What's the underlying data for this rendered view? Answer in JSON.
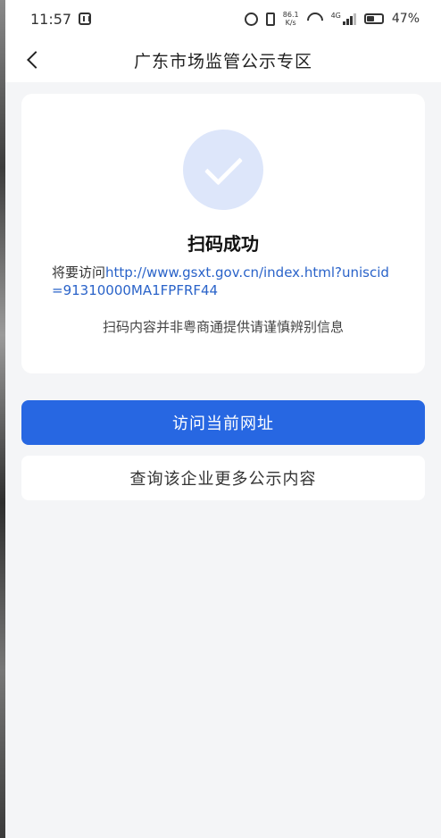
{
  "status_bar": {
    "time": "11:57",
    "net_speed_value": "86.1",
    "net_speed_unit": "K/s",
    "network_type": "4G",
    "battery": "47%",
    "battery_level": 0.47,
    "icons": [
      "nfc-icon",
      "alarm-icon",
      "vibrate-icon",
      "wifi-icon",
      "signal-icon",
      "battery-icon"
    ]
  },
  "nav": {
    "back_icon": "chevron-left-icon",
    "title": "广东市场监管公示专区"
  },
  "card": {
    "icon": "check-circle-icon",
    "title": "扫码成功",
    "visit_prefix": "将要访问",
    "url": "http://www.gsxt.gov.cn/index.html?uniscid=91310000MA1FPFRF44",
    "warning": "扫码内容并非粤商通提供请谨慎辨别信息"
  },
  "buttons": {
    "primary": "访问当前网址",
    "secondary": "查询该企业更多公示内容"
  },
  "colors": {
    "primary": "#2767e2",
    "link": "#2a63c9",
    "check_circle_bg": "#dde6fa",
    "page_bg": "#f4f5f7"
  }
}
